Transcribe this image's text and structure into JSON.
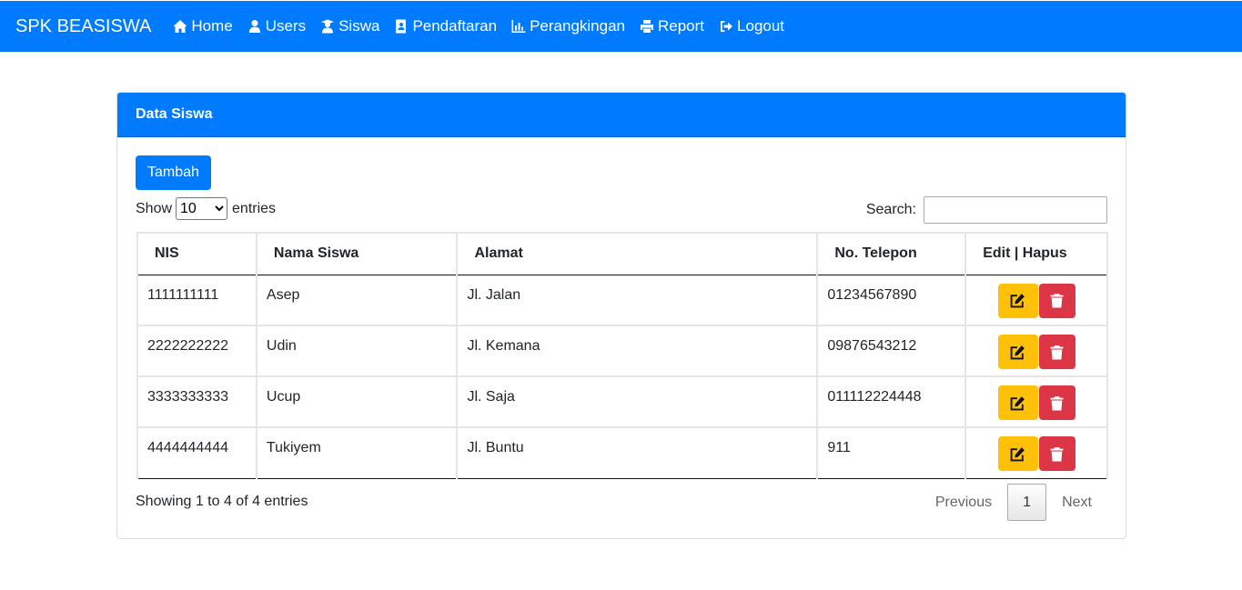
{
  "navbar": {
    "brand": "SPK BEASISWA",
    "items": [
      {
        "label": "Home",
        "icon": "home-icon"
      },
      {
        "label": "Users",
        "icon": "user-icon"
      },
      {
        "label": "Siswa",
        "icon": "student-icon"
      },
      {
        "label": "Pendaftaran",
        "icon": "address-card-icon"
      },
      {
        "label": "Perangkingan",
        "icon": "bar-chart-icon"
      },
      {
        "label": "Report",
        "icon": "print-icon"
      },
      {
        "label": "Logout",
        "icon": "sign-out-icon"
      }
    ],
    "color": "#007bff"
  },
  "card": {
    "title": "Data Siswa",
    "add_button": "Tambah"
  },
  "table_controls": {
    "show_label": "Show",
    "page_length": "10",
    "entries_label": "entries",
    "search_label": "Search:",
    "search_value": ""
  },
  "table": {
    "columns": [
      "NIS",
      "Nama Siswa",
      "Alamat",
      "No. Telepon",
      "Edit | Hapus"
    ],
    "rows": [
      {
        "nis": "1111111111",
        "nama": "Asep",
        "alamat": "Jl. Jalan",
        "telepon": "01234567890"
      },
      {
        "nis": "2222222222",
        "nama": "Udin",
        "alamat": "Jl. Kemana",
        "telepon": "09876543212"
      },
      {
        "nis": "3333333333",
        "nama": "Ucup",
        "alamat": "Jl. Saja",
        "telepon": "011112224448"
      },
      {
        "nis": "4444444444",
        "nama": "Tukiyem",
        "alamat": "Jl. Buntu",
        "telepon": "911"
      }
    ],
    "edit_color": "#ffc107",
    "delete_color": "#dc3545"
  },
  "footer": {
    "info": "Showing 1 to 4 of 4 entries",
    "previous": "Previous",
    "current_page": "1",
    "next": "Next"
  }
}
